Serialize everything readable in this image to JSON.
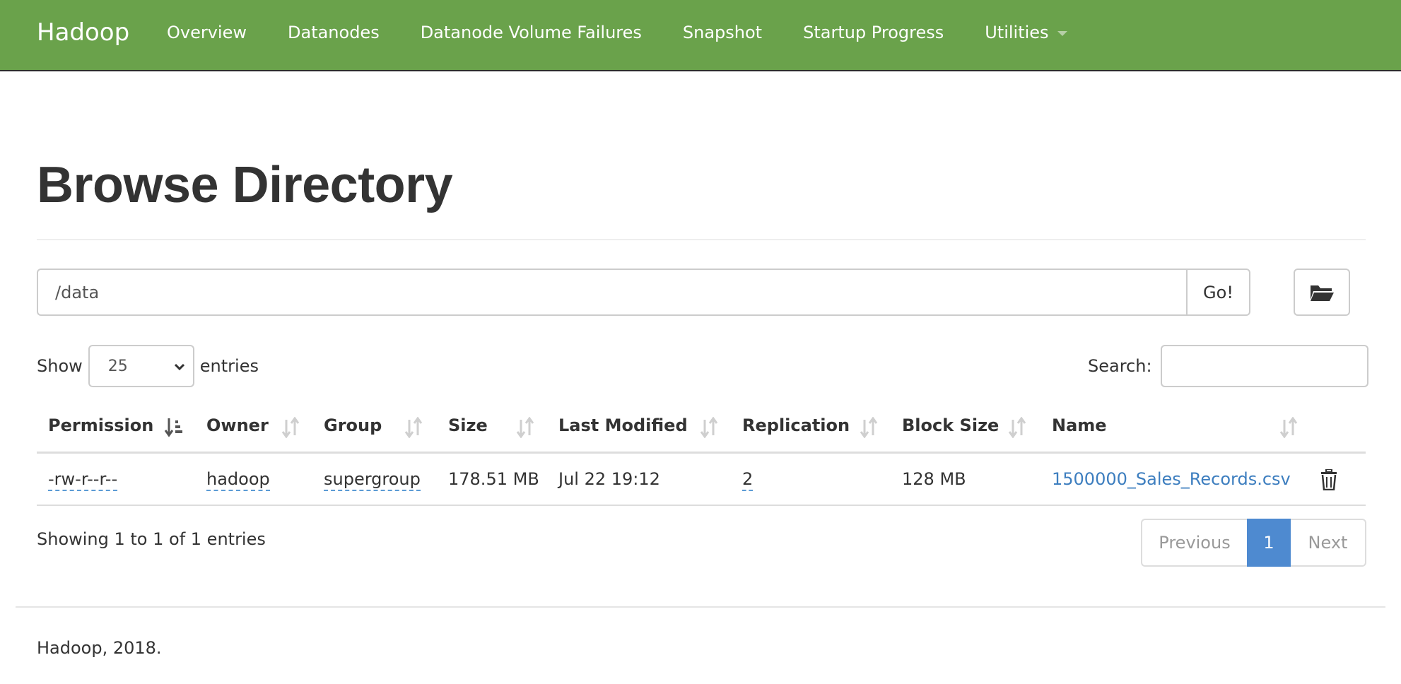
{
  "navbar": {
    "brand": "Hadoop",
    "items": [
      {
        "label": "Overview"
      },
      {
        "label": "Datanodes"
      },
      {
        "label": "Datanode Volume Failures"
      },
      {
        "label": "Snapshot"
      },
      {
        "label": "Startup Progress"
      },
      {
        "label": "Utilities",
        "has_dropdown": true
      }
    ],
    "background_color": "#6aa24b"
  },
  "page": {
    "title": "Browse Directory"
  },
  "path_bar": {
    "value": "/data",
    "go_label": "Go!",
    "folder_icon": "folder-open-icon"
  },
  "table_controls": {
    "show_label": "Show",
    "entries_value": "25",
    "entries_label": "entries",
    "search_label": "Search:",
    "search_value": ""
  },
  "table": {
    "columns": [
      {
        "label": "Permission",
        "sort": "ascending"
      },
      {
        "label": "Owner",
        "sort": "none"
      },
      {
        "label": "Group",
        "sort": "none"
      },
      {
        "label": "Size",
        "sort": "none"
      },
      {
        "label": "Last Modified",
        "sort": "none"
      },
      {
        "label": "Replication",
        "sort": "none"
      },
      {
        "label": "Block Size",
        "sort": "none"
      },
      {
        "label": "Name",
        "sort": "none"
      }
    ],
    "rows": [
      {
        "permission": "-rw-r--r--",
        "owner": "hadoop",
        "group": "supergroup",
        "size": "178.51 MB",
        "last_modified": "Jul 22 19:12",
        "replication": "2",
        "block_size": "128 MB",
        "name": "1500000_Sales_Records.csv",
        "action_icon": "trash-icon"
      }
    ],
    "link_color": "#3d7ebf"
  },
  "pagination": {
    "info": "Showing 1 to 1 of 1 entries",
    "previous_label": "Previous",
    "current_page": "1",
    "next_label": "Next",
    "active_color": "#4e8ad0"
  },
  "footer": {
    "text": "Hadoop, 2018."
  }
}
